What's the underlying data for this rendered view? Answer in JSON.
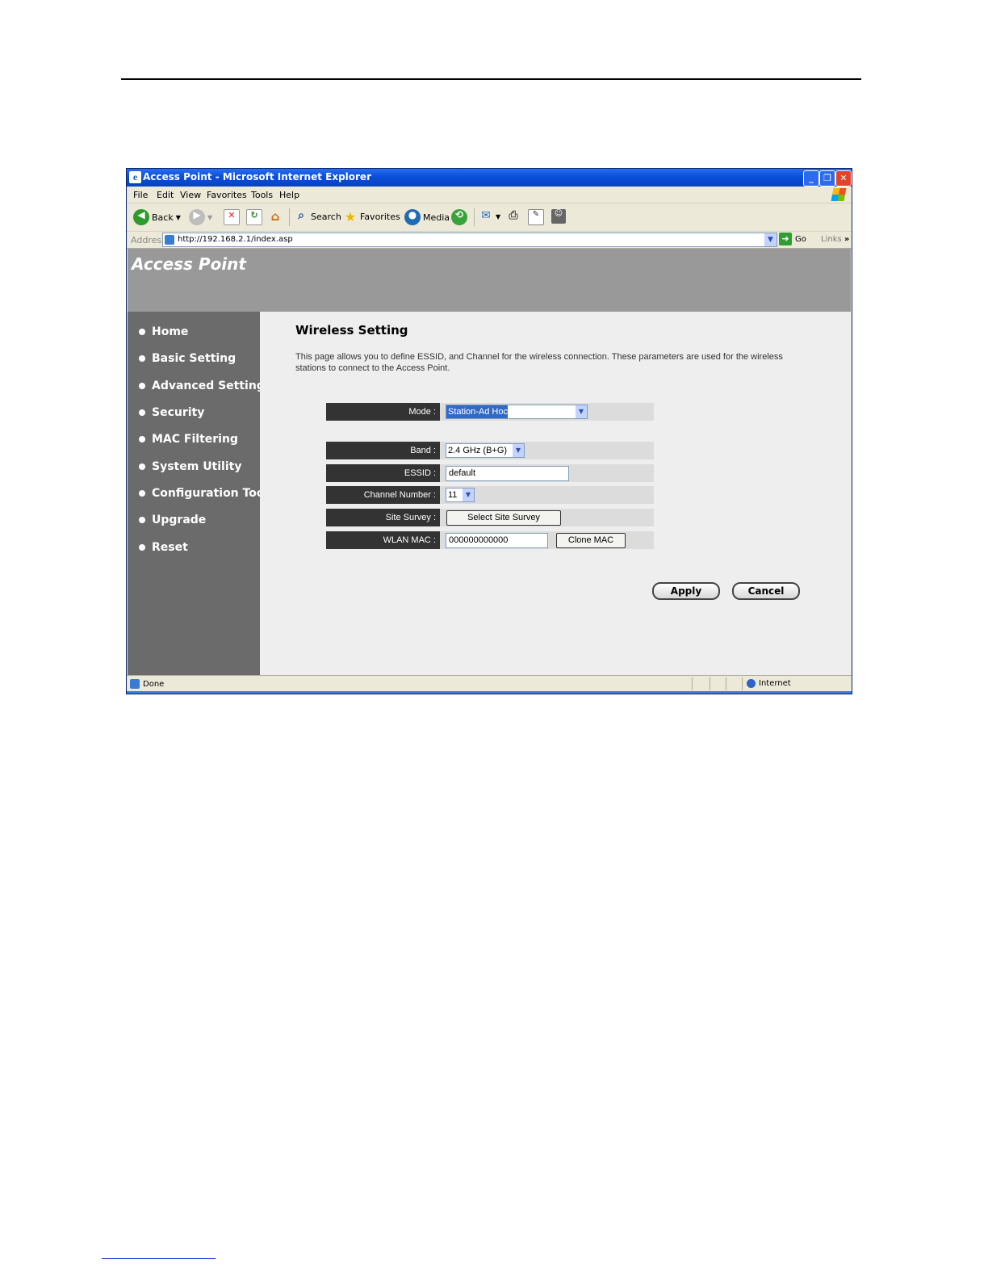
{
  "window": {
    "title": "Access Point - Microsoft Internet Explorer",
    "min_label": "_",
    "max_label": "❐",
    "close_label": "✕"
  },
  "menubar": [
    "File",
    "Edit",
    "View",
    "Favorites",
    "Tools",
    "Help"
  ],
  "toolbar": {
    "back": "Back",
    "search": "Search",
    "favorites": "Favorites",
    "media": "Media"
  },
  "addressbar": {
    "label": "Address",
    "url": "http://192.168.2.1/index.asp",
    "go": "Go",
    "links": "Links"
  },
  "page": {
    "brand": "Access Point",
    "title": "Wireless Setting",
    "description": "This page allows you to define ESSID, and Channel for the wireless connection. These parameters are used for the wireless stations to connect to the Access Point."
  },
  "sidebar": {
    "items": [
      {
        "label": "Home"
      },
      {
        "label": "Basic Setting"
      },
      {
        "label": "Advanced Setting"
      },
      {
        "label": "Security"
      },
      {
        "label": "MAC Filtering"
      },
      {
        "label": "System Utility"
      },
      {
        "label": "Configuration Tool"
      },
      {
        "label": "Upgrade"
      },
      {
        "label": "Reset"
      }
    ]
  },
  "form": {
    "mode": {
      "label": "Mode :",
      "value": "Station-Ad Hoc"
    },
    "band": {
      "label": "Band :",
      "value": "2.4 GHz (B+G)"
    },
    "essid": {
      "label": "ESSID :",
      "value": "default"
    },
    "channel": {
      "label": "Channel Number :",
      "value": "11"
    },
    "site_survey": {
      "label": "Site Survey :",
      "button": "Select Site Survey"
    },
    "wlan_mac": {
      "label": "WLAN MAC :",
      "value": "000000000000",
      "button": "Clone MAC"
    },
    "apply": "Apply",
    "cancel": "Cancel"
  },
  "statusbar": {
    "left": "Done",
    "zone": "Internet"
  }
}
